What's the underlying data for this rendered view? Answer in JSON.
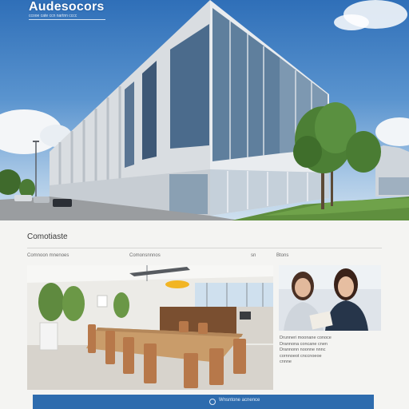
{
  "hero": {
    "brand": "Audesocors",
    "tagline": "ccooe cate ccn nartnn cccc"
  },
  "content": {
    "section_title": "Comotiaste",
    "subnav": [
      "Comnoon mnenoes",
      "Comonsnnnos",
      "sn",
      "Btons"
    ],
    "caption": [
      "Drunneri moonane conoce",
      "Drannona concane cnen",
      "Drannonn noonne nnnc",
      "cornnoeot cnccnoeoe",
      "cnnne"
    ],
    "footer_label": "Wnsntone acnence"
  },
  "colors": {
    "sky_top": "#2f6fb8",
    "accent_blue": "#2e6cae",
    "page_bg": "#f4f4f2"
  },
  "icons": {
    "footer": "circle-info-icon"
  }
}
